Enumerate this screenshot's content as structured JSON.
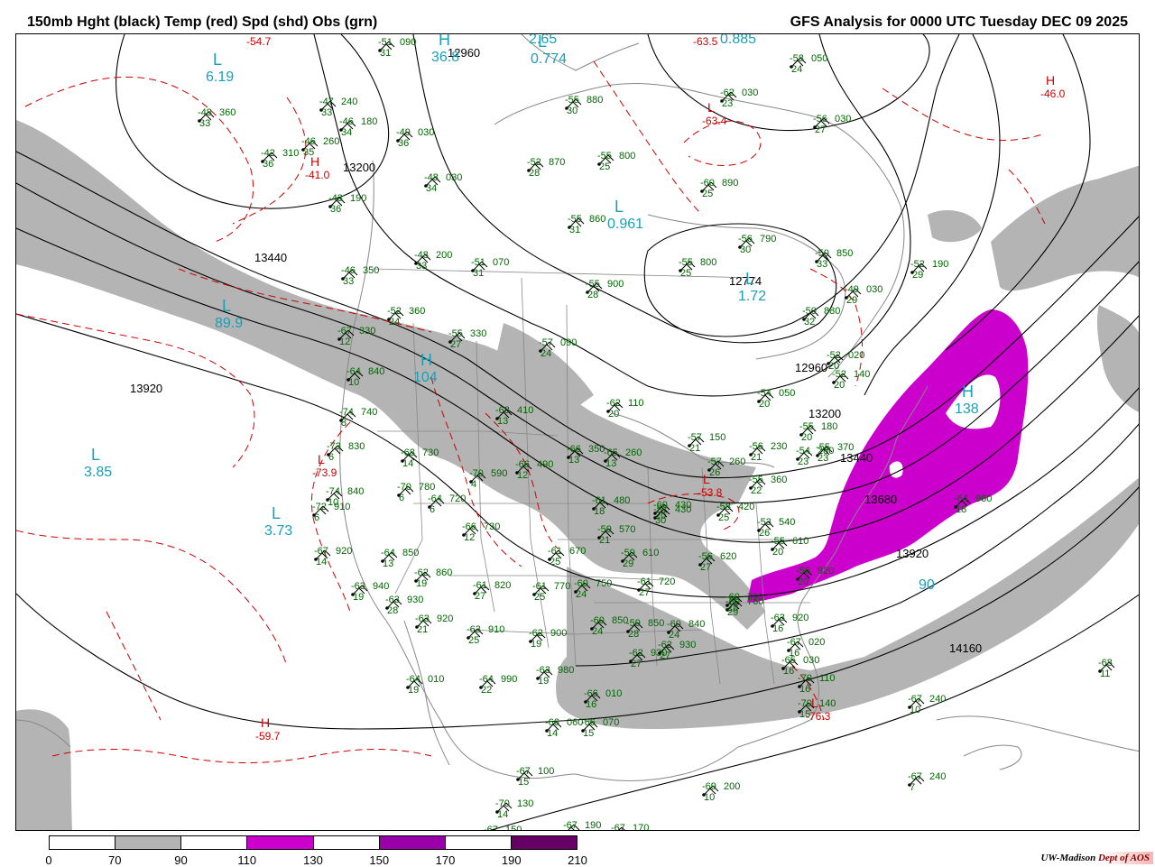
{
  "header": {
    "left_title": "150mb Hght (black) Temp (red) Spd (shd) Obs (grn)",
    "right_title": "GFS Analysis for 0000 UTC Tuesday  DEC 09 2025"
  },
  "colors": {
    "height_contour": "#000000",
    "temp_contour": "#cc0000",
    "obs_text": "#006600",
    "speed_label": "#18a0b8",
    "shade_70_90": "#b4b4b4",
    "shade_110_130": "#cc00cc",
    "shade_150_170": "#9900aa",
    "shade_190_210": "#660066",
    "coastline": "#888888"
  },
  "colorbar": {
    "ticks": [
      "0",
      "70",
      "90",
      "110",
      "130",
      "150",
      "170",
      "190",
      "210"
    ],
    "fills": [
      "#ffffff",
      "#b4b4b4",
      "#ffffff",
      "#cc00cc",
      "#ffffff",
      "#9900aa",
      "#ffffff",
      "#660066"
    ]
  },
  "height_labels": [
    "13440",
    "13200",
    "12960",
    "13920",
    "12774",
    "12960",
    "13200",
    "13440",
    "13680",
    "13920",
    "14160"
  ],
  "pressure_centers": [
    {
      "letter": "L",
      "value": "6.19",
      "color": "speed"
    },
    {
      "letter": "H",
      "value": "36.8",
      "color": "speed"
    },
    {
      "letter": "L",
      "value": "2.65",
      "color": "speed"
    },
    {
      "letter": "L",
      "value": "0.774",
      "color": "speed"
    },
    {
      "letter": "L",
      "value": "0.885",
      "color": "speed"
    },
    {
      "letter": "L",
      "value": "0.961",
      "color": "speed"
    },
    {
      "letter": "L",
      "value": "89.9",
      "color": "speed"
    },
    {
      "letter": "H",
      "value": "104",
      "color": "speed"
    },
    {
      "letter": "L",
      "value": "3.85",
      "color": "speed"
    },
    {
      "letter": "L",
      "value": "3.73",
      "color": "speed"
    },
    {
      "letter": "L",
      "value": "1.72",
      "color": "speed"
    },
    {
      "letter": "H",
      "value": "138",
      "color": "speed"
    },
    {
      "letter": "",
      "value": "90",
      "color": "speed"
    },
    {
      "letter": "L",
      "value": "-54.7",
      "color": "temp"
    },
    {
      "letter": "H",
      "value": "-41.0",
      "color": "temp"
    },
    {
      "letter": "L",
      "value": "-63.5",
      "color": "temp"
    },
    {
      "letter": "L",
      "value": "-63.4",
      "color": "temp"
    },
    {
      "letter": "H",
      "value": "-46.0",
      "color": "temp"
    },
    {
      "letter": "L",
      "value": "-73.9",
      "color": "temp"
    },
    {
      "letter": "L",
      "value": "-53.8",
      "color": "temp"
    },
    {
      "letter": "H",
      "value": "-59.7",
      "color": "temp"
    },
    {
      "letter": "L",
      "value": "-76.3",
      "color": "temp"
    }
  ],
  "observations": [
    {
      "t": "-51",
      "h": "090",
      "s": "31"
    },
    {
      "t": "-47",
      "h": "240",
      "s": "33"
    },
    {
      "t": "-48",
      "h": "360",
      "s": "33"
    },
    {
      "t": "-46",
      "h": "180",
      "s": "34"
    },
    {
      "t": "-46",
      "h": "260",
      "s": "35"
    },
    {
      "t": "-42",
      "h": "310",
      "s": "36"
    },
    {
      "t": "-49",
      "h": "030",
      "s": "36"
    },
    {
      "t": "-48",
      "h": "030",
      "s": "34"
    },
    {
      "t": "-43",
      "h": "190",
      "s": "36"
    },
    {
      "t": "-48",
      "h": "200",
      "s": "33"
    },
    {
      "t": "-51",
      "h": "070",
      "s": "31"
    },
    {
      "t": "-46",
      "h": "350",
      "s": "33"
    },
    {
      "t": "-55",
      "h": "880",
      "s": "30"
    },
    {
      "t": "-52",
      "h": "870",
      "s": "28"
    },
    {
      "t": "-55",
      "h": "800",
      "s": "25"
    },
    {
      "t": "-60",
      "h": "890",
      "s": "25"
    },
    {
      "t": "-62",
      "h": "030",
      "s": "23"
    },
    {
      "t": "-58",
      "h": "050",
      "s": "24"
    },
    {
      "t": "-56",
      "h": "030",
      "s": "27"
    },
    {
      "t": "-55",
      "h": "860",
      "s": "31"
    },
    {
      "t": "-56",
      "h": "790",
      "s": "30"
    },
    {
      "t": "-55",
      "h": "800",
      "s": "25"
    },
    {
      "t": "-50",
      "h": "850",
      "s": "33"
    },
    {
      "t": "-55",
      "h": "900",
      "s": "28"
    },
    {
      "t": "-52",
      "h": "360",
      "s": "24"
    },
    {
      "t": "-55",
      "h": "330",
      "s": "27"
    },
    {
      "t": "-57",
      "h": "090",
      "s": "24"
    },
    {
      "t": "-50",
      "h": "880",
      "s": "32"
    },
    {
      "t": "-49",
      "h": "030",
      "s": "29"
    },
    {
      "t": "-52",
      "h": "190",
      "s": "29"
    },
    {
      "t": "-67",
      "h": "330",
      "s": "12"
    },
    {
      "t": "-64",
      "h": "840",
      "s": "10"
    },
    {
      "t": "-74",
      "h": "740",
      "s": "8"
    },
    {
      "t": "-73",
      "h": "830",
      "s": "6"
    },
    {
      "t": "-68",
      "h": "730",
      "s": "14"
    },
    {
      "t": "-63",
      "h": "410",
      "s": "13"
    },
    {
      "t": "-66",
      "h": "490",
      "s": "12"
    },
    {
      "t": "-62",
      "h": "110",
      "s": "20"
    },
    {
      "t": "-66",
      "h": "350",
      "s": "13"
    },
    {
      "t": "-65",
      "h": "260",
      "s": "13"
    },
    {
      "t": "-70",
      "h": "590",
      "s": "4"
    },
    {
      "t": "-70",
      "h": "780",
      "s": "6"
    },
    {
      "t": "-64",
      "h": "720",
      "s": "6"
    },
    {
      "t": "-74",
      "h": "840",
      "s": "10"
    },
    {
      "t": "-72",
      "h": "910",
      "s": "6"
    },
    {
      "t": "-66",
      "h": "730",
      "s": "12"
    },
    {
      "t": "-67",
      "h": "920",
      "s": "14"
    },
    {
      "t": "-64",
      "h": "850",
      "s": "13"
    },
    {
      "t": "-62",
      "h": "860",
      "s": "19"
    },
    {
      "t": "-61",
      "h": "820",
      "s": "27"
    },
    {
      "t": "-63",
      "h": "940",
      "s": "19"
    },
    {
      "t": "-63",
      "h": "930",
      "s": "28"
    },
    {
      "t": "-63",
      "h": "920",
      "s": "21"
    },
    {
      "t": "-63",
      "h": "910",
      "s": "25"
    },
    {
      "t": "-62",
      "h": "900",
      "s": "19"
    },
    {
      "t": "-64",
      "h": "010",
      "s": "19"
    },
    {
      "t": "-64",
      "h": "990",
      "s": "22"
    },
    {
      "t": "-63",
      "h": "980",
      "s": "19"
    },
    {
      "t": "-66",
      "h": "010",
      "s": "16"
    },
    {
      "t": "-66",
      "h": "060",
      "s": "14"
    },
    {
      "t": "-66",
      "h": "070",
      "s": "15"
    },
    {
      "t": "-67",
      "h": "100",
      "s": "15"
    },
    {
      "t": "-70",
      "h": "130",
      "s": "14"
    },
    {
      "t": "-67",
      "h": "150",
      "s": "13"
    },
    {
      "t": "-67",
      "h": "190",
      "s": "13"
    },
    {
      "t": "-67",
      "h": "170",
      "s": "12"
    },
    {
      "t": "-69",
      "h": "200",
      "s": "10"
    },
    {
      "t": "-67",
      "h": "240",
      "s": "7"
    },
    {
      "t": "-67",
      "h": "240",
      "s": "10"
    },
    {
      "t": "-68",
      "h": "",
      "s": "11"
    },
    {
      "t": "-61",
      "h": "480",
      "s": "18"
    },
    {
      "t": "-60",
      "h": "430",
      "s": "20"
    },
    {
      "t": "-57",
      "h": "430",
      "s": "30"
    },
    {
      "t": "-58",
      "h": "420",
      "s": "25"
    },
    {
      "t": "-59",
      "h": "570",
      "s": "21"
    },
    {
      "t": "-61",
      "h": "670",
      "s": "25"
    },
    {
      "t": "-61",
      "h": "770",
      "s": "25"
    },
    {
      "t": "-60",
      "h": "750",
      "s": "24"
    },
    {
      "t": "-59",
      "h": "610",
      "s": "29"
    },
    {
      "t": "-61",
      "h": "720",
      "s": "27"
    },
    {
      "t": "-56",
      "h": "620",
      "s": "27"
    },
    {
      "t": "-60",
      "h": "850",
      "s": "24"
    },
    {
      "t": "-59",
      "h": "850",
      "s": "28"
    },
    {
      "t": "-60",
      "h": "840",
      "s": "24"
    },
    {
      "t": "-62",
      "h": "930",
      "s": "27"
    },
    {
      "t": "-62",
      "h": "930",
      "s": "27"
    },
    {
      "t": "-60",
      "h": "760",
      "s": "29"
    },
    {
      "t": "-60",
      "h": "790",
      "s": "28"
    },
    {
      "t": "-57",
      "h": "150",
      "s": "21"
    },
    {
      "t": "-57",
      "h": "260",
      "s": "26"
    },
    {
      "t": "-56",
      "h": "230",
      "s": "21"
    },
    {
      "t": "-55",
      "h": "360",
      "s": "22"
    },
    {
      "t": "-54",
      "h": "050",
      "s": "20"
    },
    {
      "t": "-52",
      "h": "140",
      "s": "20"
    },
    {
      "t": "-55",
      "h": "180",
      "s": "20"
    },
    {
      "t": "-54",
      "h": "280",
      "s": "23"
    },
    {
      "t": "-55",
      "h": "370",
      "s": "23"
    },
    {
      "t": "-53",
      "h": "540",
      "s": "26"
    },
    {
      "t": "-55",
      "h": "610",
      "s": "20"
    },
    {
      "t": "-56",
      "h": "920",
      "s": "20"
    },
    {
      "t": "-63",
      "h": "920",
      "s": "16"
    },
    {
      "t": "-67",
      "h": "020",
      "s": "16"
    },
    {
      "t": "-65",
      "h": "030",
      "s": "16"
    },
    {
      "t": "-70",
      "h": "110",
      "s": "16"
    },
    {
      "t": "-70",
      "h": "140",
      "s": "15"
    },
    {
      "t": "-64",
      "h": "960",
      "s": "18"
    },
    {
      "t": "-52",
      "h": "020",
      "s": "20"
    }
  ],
  "credit": {
    "left": "UW-Madison",
    "right": "Dept of AOS"
  }
}
